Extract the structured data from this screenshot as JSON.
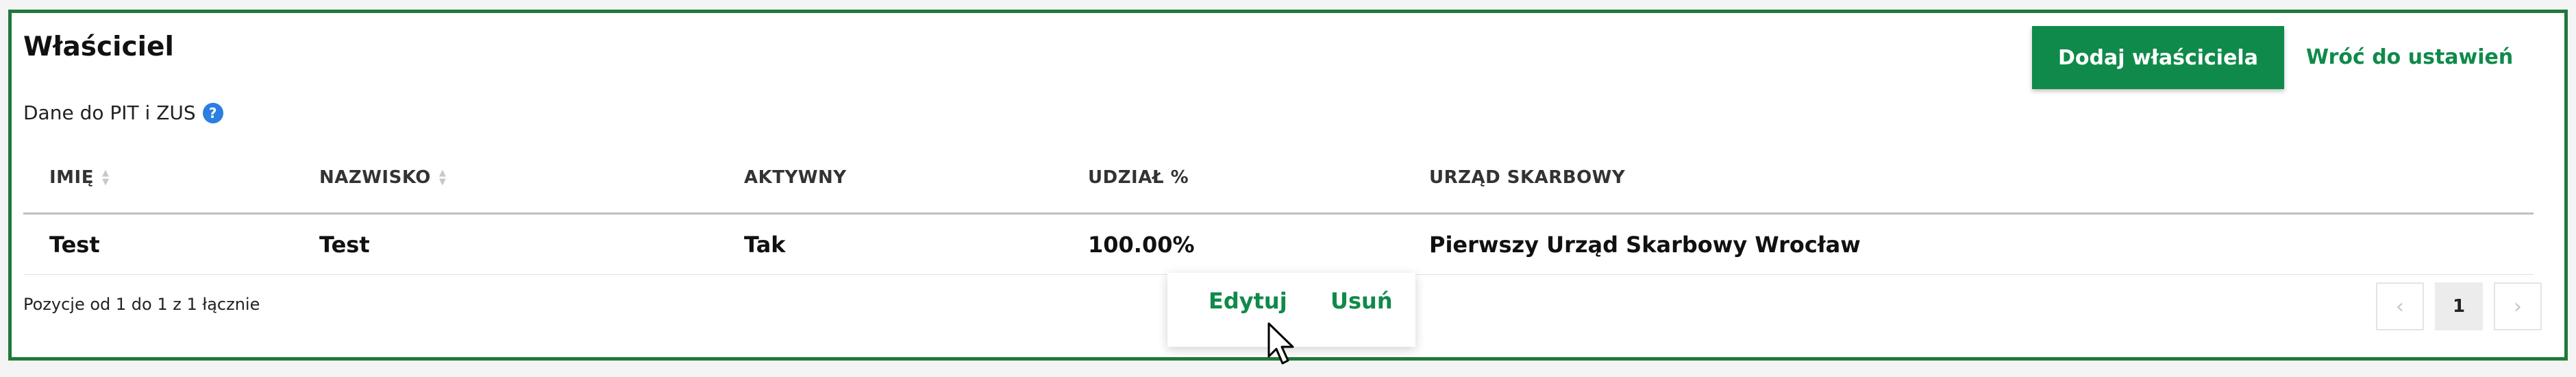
{
  "section": {
    "title": "Właściciel",
    "subtitle": "Dane do PIT i ZUS",
    "help_icon": "question-mark-icon"
  },
  "actions": {
    "add_owner": "Dodaj właściciela",
    "back_to_settings": "Wróć do ustawień"
  },
  "table": {
    "columns": [
      "IMIĘ",
      "NAZWISKO",
      "AKTYWNY",
      "UDZIAŁ %",
      "URZĄD SKARBOWY"
    ],
    "rows": [
      {
        "first_name": "Test",
        "last_name": "Test",
        "active": "Tak",
        "share": "100.00%",
        "tax_office": "Pierwszy Urząd Skarbowy Wrocław"
      }
    ]
  },
  "context_menu": {
    "edit": "Edytuj",
    "delete": "Usuń"
  },
  "footer": {
    "info": "Pozycje od 1 do 1 z 1 łącznie"
  },
  "pagination": {
    "prev": "‹",
    "current": "1",
    "next": "›"
  },
  "colors": {
    "accent": "#0f8a4a",
    "border": "#1f7a3a",
    "help": "#2a7fe0"
  }
}
